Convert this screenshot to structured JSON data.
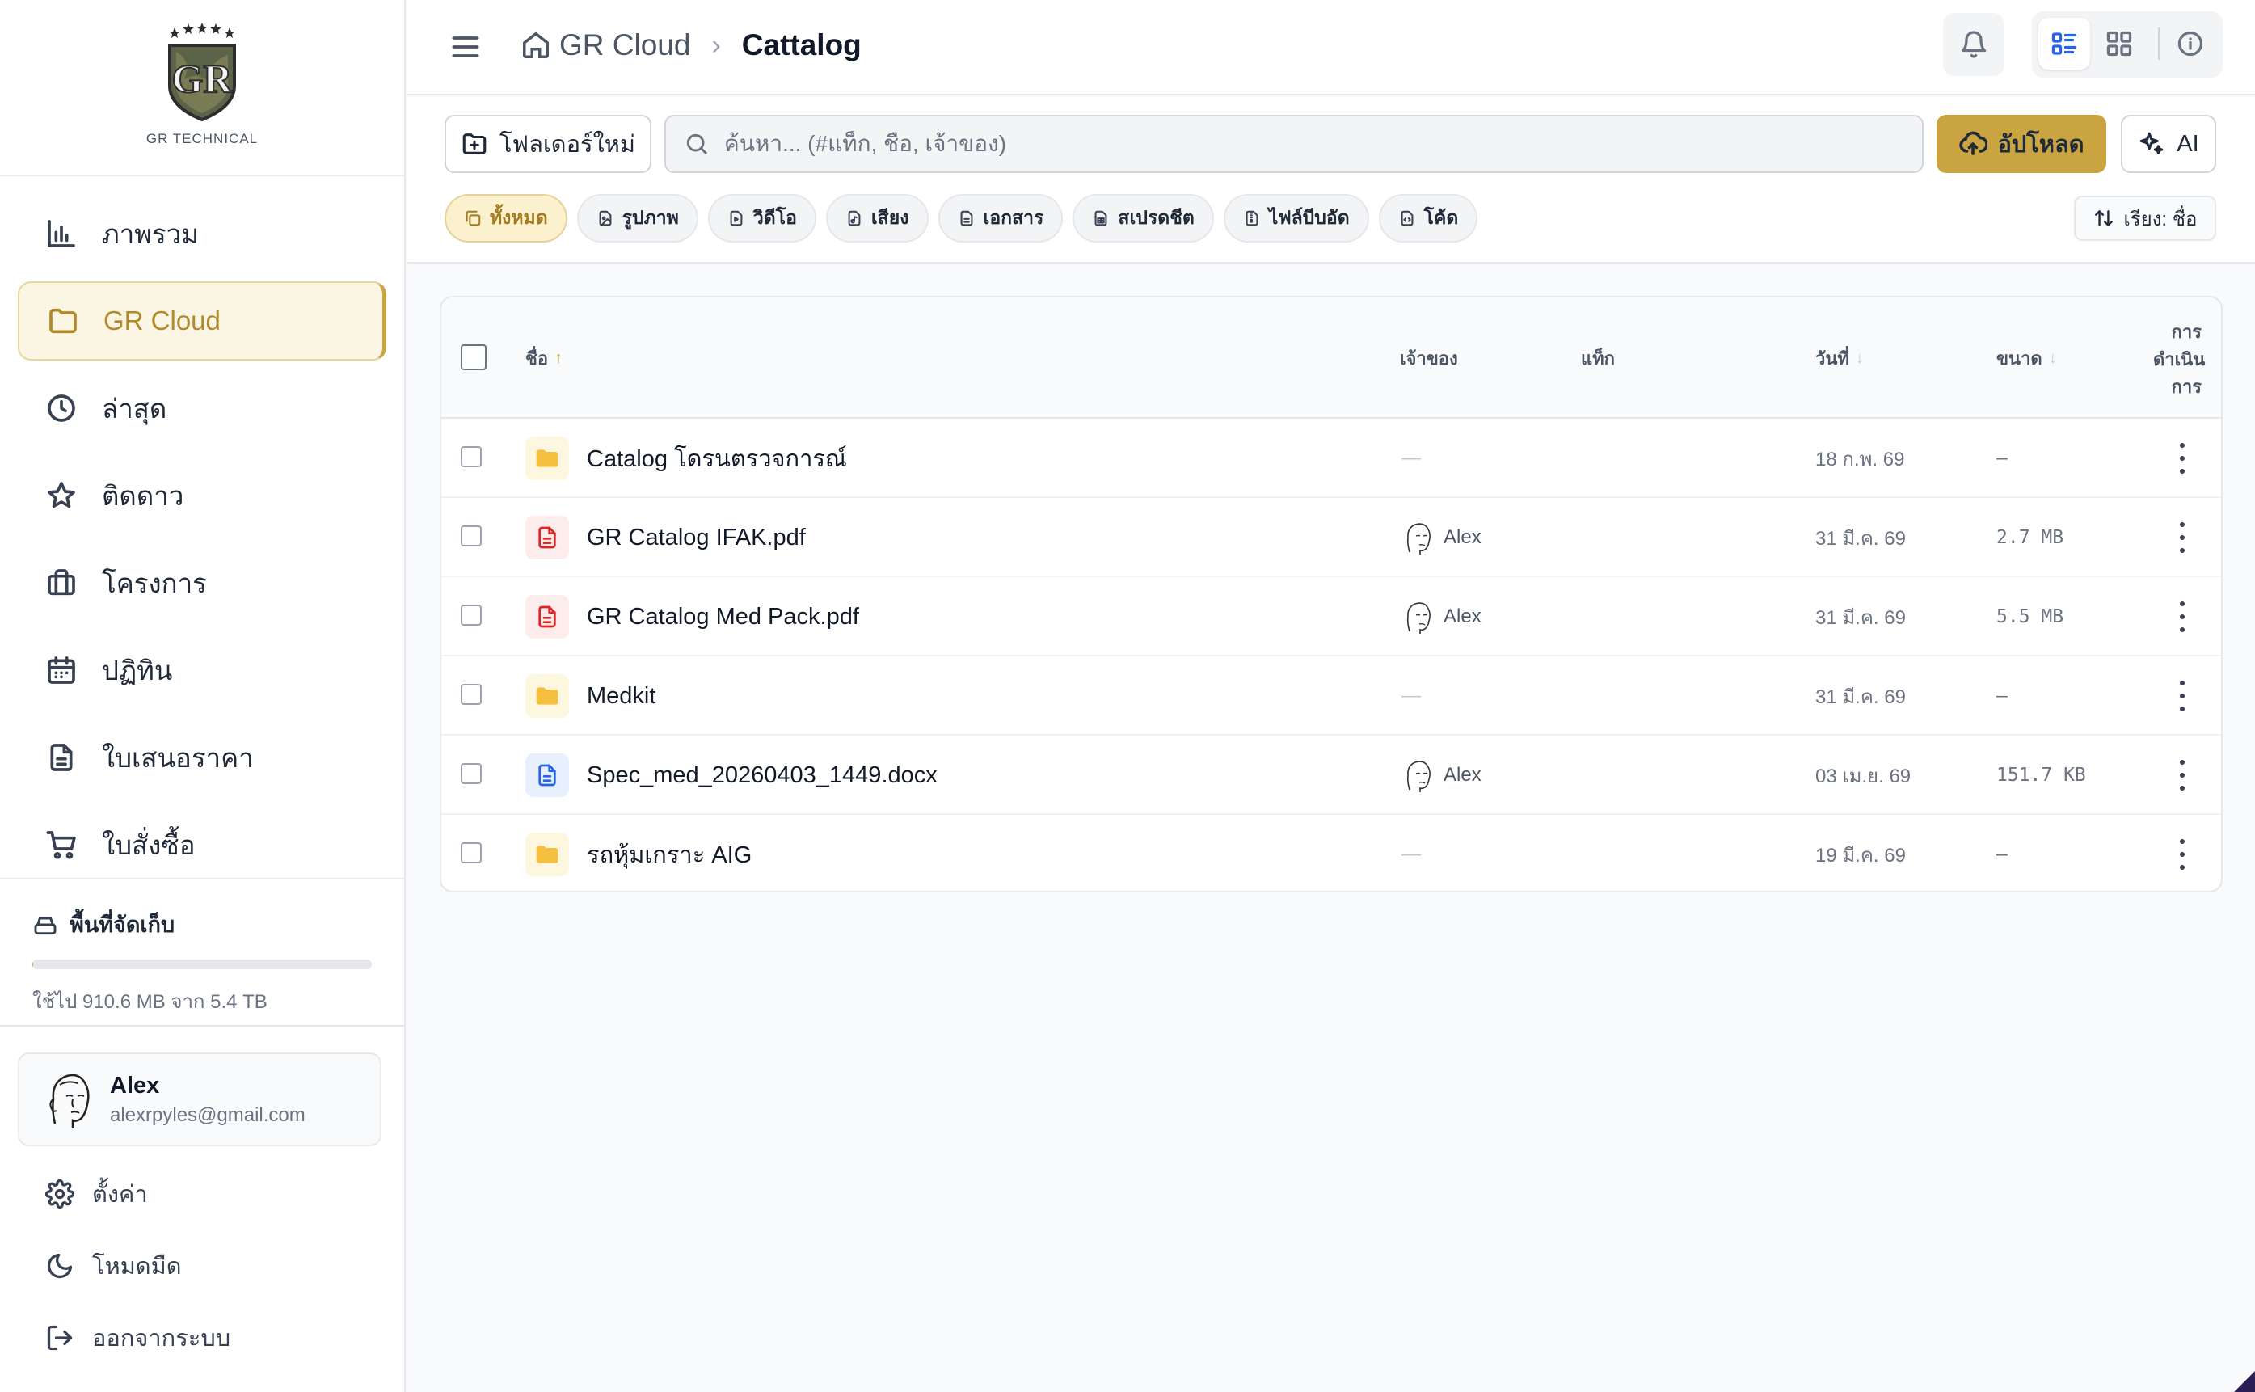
{
  "app": {
    "logo_text": "GR TECHNICAL",
    "logo_letters": "GR",
    "accent_color": "#c9a441"
  },
  "sidebar": {
    "items": [
      {
        "label": "ภาพรวม",
        "icon": "bar-chart-icon",
        "active": false
      },
      {
        "label": "GR Cloud",
        "icon": "folder-icon",
        "active": true
      },
      {
        "label": "ล่าสุด",
        "icon": "clock-icon",
        "active": false
      },
      {
        "label": "ติดดาว",
        "icon": "star-icon",
        "active": false
      },
      {
        "label": "โครงการ",
        "icon": "briefcase-icon",
        "active": false
      },
      {
        "label": "ปฏิทิน",
        "icon": "calendar-icon",
        "active": false
      },
      {
        "label": "ใบเสนอราคา",
        "icon": "document-icon",
        "active": false
      },
      {
        "label": "ใบสั่งซื้อ",
        "icon": "cart-icon",
        "active": false
      }
    ],
    "storage": {
      "title": "พื้นที่จัดเก็บ",
      "usage_text": "ใช้ไป 910.6 MB จาก 5.4 TB",
      "used_fraction": 0.0002
    },
    "user": {
      "name": "Alex",
      "email": "alexrpyles@gmail.com"
    },
    "settings_label": "ตั้งค่า",
    "dark_mode_label": "โหมดมืด",
    "logout_label": "ออกจากระบบ"
  },
  "header": {
    "breadcrumb_root": "GR Cloud",
    "breadcrumb_current": "Cattalog"
  },
  "toolbar": {
    "new_folder_label": "โฟลเดอร์ใหม่",
    "search_placeholder": "ค้นหา... (#แท็ก, ชื่อ, เจ้าของ)",
    "upload_label": "อัปโหลด",
    "ai_label": "AI",
    "sort_label": "เรียง: ชื่อ",
    "filters": [
      {
        "label": "ทั้งหมด",
        "active": true
      },
      {
        "label": "รูปภาพ",
        "active": false
      },
      {
        "label": "วิดีโอ",
        "active": false
      },
      {
        "label": "เสียง",
        "active": false
      },
      {
        "label": "เอกสาร",
        "active": false
      },
      {
        "label": "สเปรดชีต",
        "active": false
      },
      {
        "label": "ไฟล์บีบอัด",
        "active": false
      },
      {
        "label": "โค้ด",
        "active": false
      }
    ]
  },
  "table": {
    "headers": {
      "name": "ชื่อ",
      "owner": "เจ้าของ",
      "tags": "แท็ก",
      "date": "วันที่",
      "size": "ขนาด",
      "actions": [
        "การ",
        "ดำเนิน",
        "การ"
      ]
    },
    "rows": [
      {
        "type": "folder",
        "name": "Catalog โดรนตรวจการณ์",
        "owner": "—",
        "date": "18 ก.พ. 69",
        "size": "—"
      },
      {
        "type": "pdf",
        "name": "GR Catalog IFAK.pdf",
        "owner": "Alex",
        "date": "31 มี.ค. 69",
        "size": "2.7 MB"
      },
      {
        "type": "pdf",
        "name": "GR Catalog Med Pack.pdf",
        "owner": "Alex",
        "date": "31 มี.ค. 69",
        "size": "5.5 MB"
      },
      {
        "type": "folder",
        "name": "Medkit",
        "owner": "—",
        "date": "31 มี.ค. 69",
        "size": "—"
      },
      {
        "type": "doc",
        "name": "Spec_med_20260403_1449.docx",
        "owner": "Alex",
        "date": "03 เม.ย. 69",
        "size": "151.7 KB"
      },
      {
        "type": "folder",
        "name": "รถหุ้มเกราะ AIG",
        "owner": "—",
        "date": "19 มี.ค. 69",
        "size": "—"
      }
    ]
  }
}
